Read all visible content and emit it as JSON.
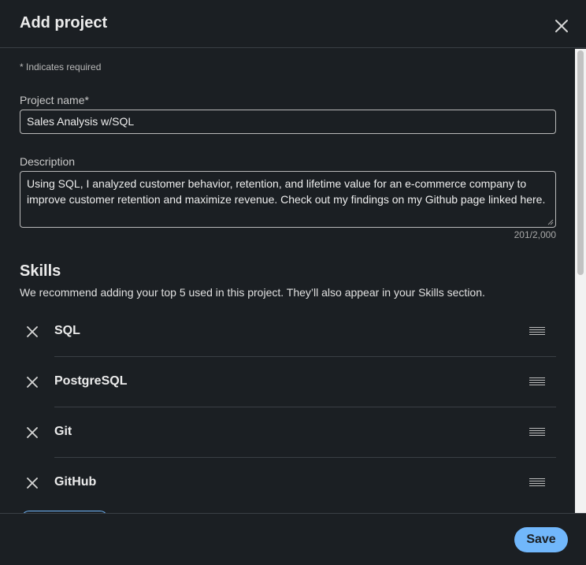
{
  "header": {
    "title": "Add project",
    "close_icon": "close-icon"
  },
  "form": {
    "required_note": "* Indicates required",
    "project_name": {
      "label": "Project name*",
      "value": "Sales Analysis w/SQL"
    },
    "description": {
      "label": "Description",
      "value": "Using SQL, I analyzed customer behavior, retention, and lifetime value for an e-commerce company to improve customer retention and maximize revenue. Check out my findings on my Github page linked here.",
      "char_count": "201/2,000"
    }
  },
  "skills": {
    "title": "Skills",
    "subtitle": "We recommend adding your top 5 used in this project. They’ll also appear in your Skills section.",
    "items": [
      {
        "name": "SQL"
      },
      {
        "name": "PostgreSQL"
      },
      {
        "name": "Git"
      },
      {
        "name": "GitHub"
      }
    ]
  },
  "footer": {
    "save_label": "Save"
  },
  "colors": {
    "background": "#1b1f23",
    "accent": "#71b7fb",
    "divider": "#3a3f45"
  }
}
